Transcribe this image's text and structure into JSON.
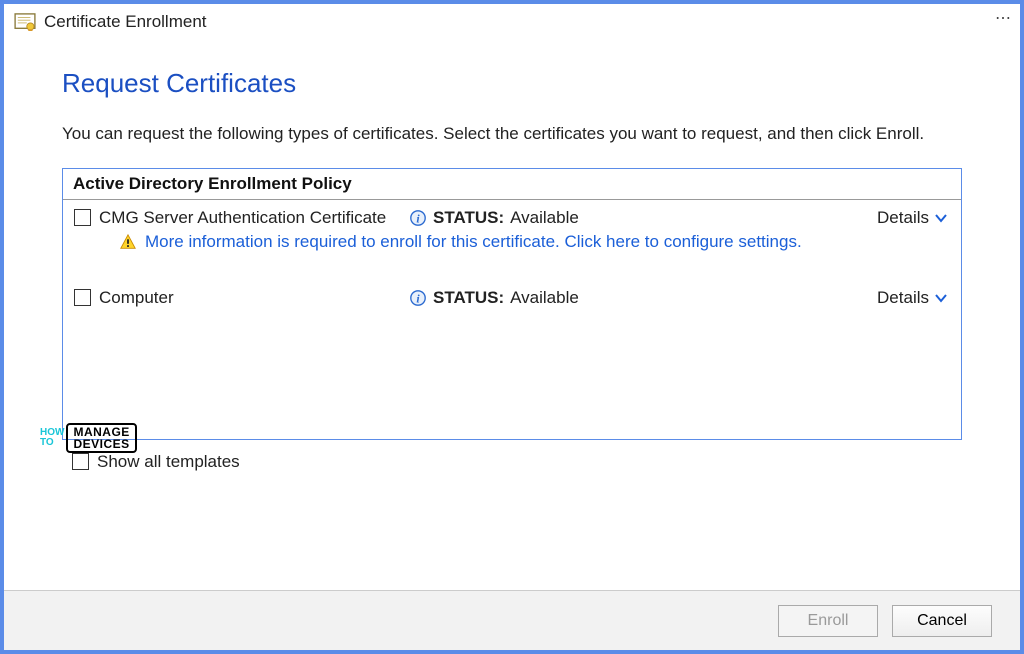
{
  "titlebar": {
    "title": "Certificate Enrollment",
    "dots": "⋯"
  },
  "page": {
    "heading": "Request Certificates",
    "description": "You can request the following types of certificates. Select the certificates you want to request, and then click Enroll."
  },
  "policy": {
    "header": "Active Directory Enrollment Policy",
    "certificates": [
      {
        "name": "CMG Server Authentication Certificate",
        "status_label": "STATUS:",
        "status_value": "Available",
        "details_label": "Details",
        "warning": "More information is required to enroll for this certificate. Click here to configure settings."
      },
      {
        "name": "Computer",
        "status_label": "STATUS:",
        "status_value": "Available",
        "details_label": "Details"
      }
    ]
  },
  "show_all": {
    "label": "Show all templates"
  },
  "footer": {
    "enroll": "Enroll",
    "cancel": "Cancel"
  },
  "watermark": {
    "how": "HOW",
    "to": "TO",
    "manage": "MANAGE",
    "devices": "DEVICES"
  }
}
